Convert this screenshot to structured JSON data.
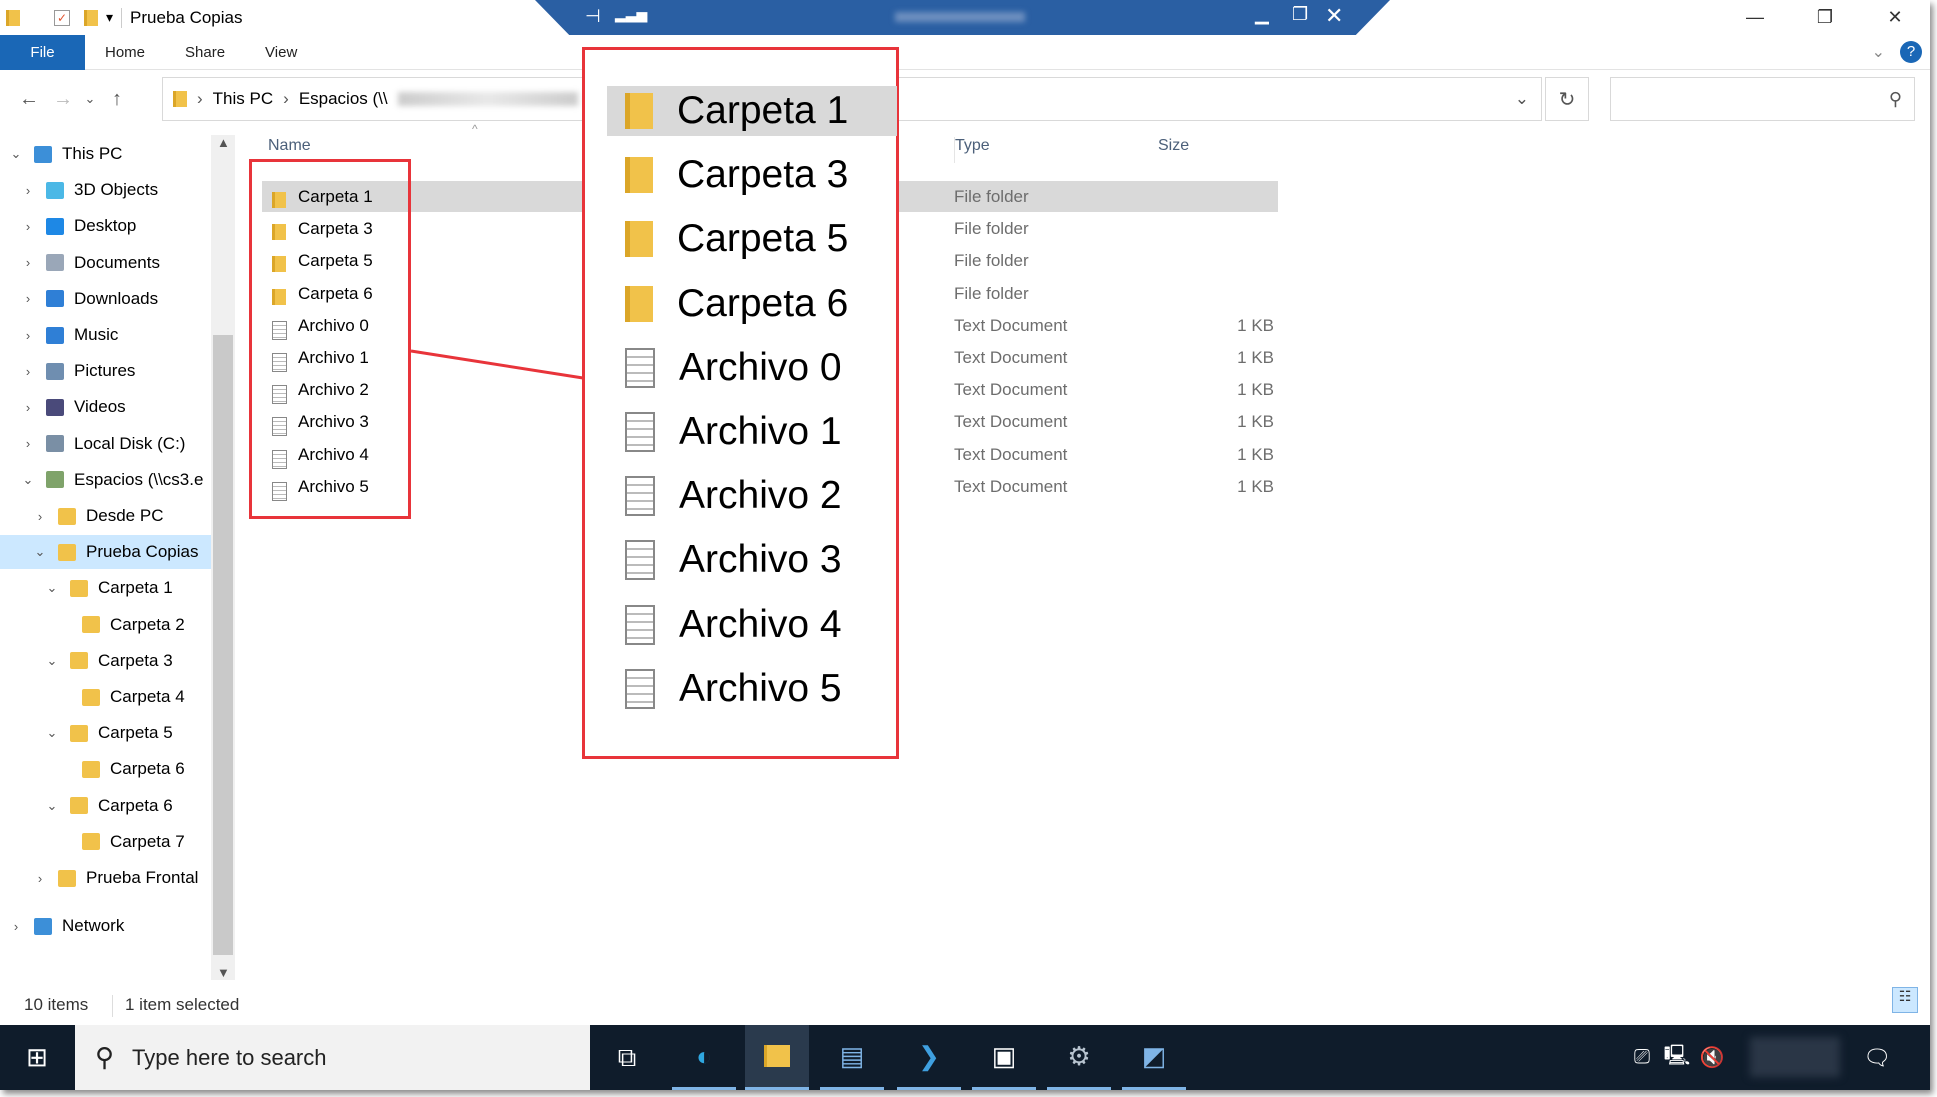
{
  "window": {
    "title": "Prueba Copias",
    "minimize": "—",
    "maximize": "❐",
    "close": "✕"
  },
  "ribbon": {
    "tabs": [
      "File",
      "Home",
      "Share",
      "View"
    ]
  },
  "address": {
    "segments": [
      "This PC",
      "Espacios (\\\\"
    ],
    "search_placeholder": ""
  },
  "sidebar": [
    {
      "label": "This PC",
      "level": 0,
      "chev": "v",
      "icon": "pc",
      "color": "#3c8fd8"
    },
    {
      "label": "3D Objects",
      "level": 1,
      "chev": ">",
      "icon": "3d",
      "color": "#4bb8e6"
    },
    {
      "label": "Desktop",
      "level": 1,
      "chev": ">",
      "icon": "desktop",
      "color": "#1e88e5"
    },
    {
      "label": "Documents",
      "level": 1,
      "chev": ">",
      "icon": "documents",
      "color": "#9aa7b8"
    },
    {
      "label": "Downloads",
      "level": 1,
      "chev": ">",
      "icon": "downloads",
      "color": "#2f7fd6"
    },
    {
      "label": "Music",
      "level": 1,
      "chev": ">",
      "icon": "music",
      "color": "#2f7fd6"
    },
    {
      "label": "Pictures",
      "level": 1,
      "chev": ">",
      "icon": "pictures",
      "color": "#6f8eb0"
    },
    {
      "label": "Videos",
      "level": 1,
      "chev": ">",
      "icon": "videos",
      "color": "#4a4a7a"
    },
    {
      "label": "Local Disk (C:)",
      "level": 1,
      "chev": ">",
      "icon": "disk",
      "color": "#7a8fa5"
    },
    {
      "label": "Espacios (\\\\cs3.e",
      "level": 1,
      "chev": "v",
      "icon": "network-drive",
      "color": "#7fa36a"
    },
    {
      "label": "Desde PC",
      "level": 2,
      "chev": ">",
      "icon": "folder",
      "color": "#f1c24a"
    },
    {
      "label": "Prueba Copias",
      "level": 2,
      "chev": "v",
      "icon": "folder",
      "color": "#f1c24a",
      "selected": true
    },
    {
      "label": "Carpeta 1",
      "level": 3,
      "chev": "v",
      "icon": "folder",
      "color": "#f1c24a"
    },
    {
      "label": "Carpeta 2",
      "level": 4,
      "chev": "",
      "icon": "folder",
      "color": "#f1c24a"
    },
    {
      "label": "Carpeta 3",
      "level": 3,
      "chev": "v",
      "icon": "folder",
      "color": "#f1c24a"
    },
    {
      "label": "Carpeta 4",
      "level": 4,
      "chev": "",
      "icon": "folder",
      "color": "#f1c24a"
    },
    {
      "label": "Carpeta 5",
      "level": 3,
      "chev": "v",
      "icon": "folder",
      "color": "#f1c24a"
    },
    {
      "label": "Carpeta 6",
      "level": 4,
      "chev": "",
      "icon": "folder",
      "color": "#f1c24a"
    },
    {
      "label": "Carpeta 6",
      "level": 3,
      "chev": "v",
      "icon": "folder",
      "color": "#f1c24a"
    },
    {
      "label": "Carpeta 7",
      "level": 4,
      "chev": "",
      "icon": "folder",
      "color": "#f1c24a"
    },
    {
      "label": "Prueba Frontal",
      "level": 2,
      "chev": ">",
      "icon": "folder",
      "color": "#f1c24a"
    },
    {
      "label": "Network",
      "level": 0,
      "chev": ">",
      "icon": "network",
      "color": "#3c8fd8",
      "gap": true
    }
  ],
  "columns": {
    "name": "Name",
    "type": "Type",
    "size": "Size"
  },
  "files": [
    {
      "name": "Carpeta 1",
      "type": "File folder",
      "size": "",
      "kind": "folder",
      "selected": true
    },
    {
      "name": "Carpeta 3",
      "type": "File folder",
      "size": "",
      "kind": "folder"
    },
    {
      "name": "Carpeta 5",
      "type": "File folder",
      "size": "",
      "kind": "folder"
    },
    {
      "name": "Carpeta 6",
      "type": "File folder",
      "size": "",
      "kind": "folder"
    },
    {
      "name": "Archivo 0",
      "type": "Text Document",
      "size": "1 KB",
      "kind": "doc"
    },
    {
      "name": "Archivo 1",
      "type": "Text Document",
      "size": "1 KB",
      "kind": "doc"
    },
    {
      "name": "Archivo 2",
      "type": "Text Document",
      "size": "1 KB",
      "kind": "doc"
    },
    {
      "name": "Archivo 3",
      "type": "Text Document",
      "size": "1 KB",
      "kind": "doc"
    },
    {
      "name": "Archivo 4",
      "type": "Text Document",
      "size": "1 KB",
      "kind": "doc"
    },
    {
      "name": "Archivo 5",
      "type": "Text Document",
      "size": "1 KB",
      "kind": "doc"
    }
  ],
  "status": {
    "count": "10 items",
    "selected": "1 item selected"
  },
  "taskbar": {
    "search_placeholder": "Type here to search"
  },
  "colors": {
    "accent": "#1a67b6",
    "highlight": "#e8343a",
    "selection": "#cce8ff",
    "taskbar": "#0f1c2b"
  }
}
